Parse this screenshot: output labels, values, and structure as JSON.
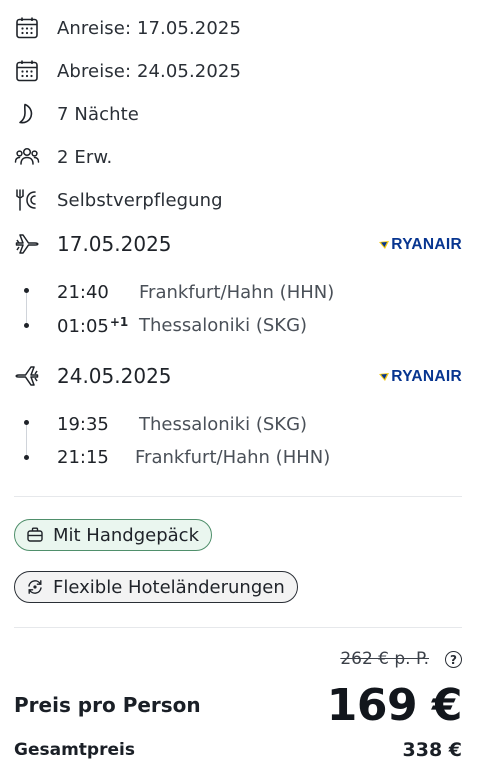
{
  "trip": {
    "arrival": "Anreise: 17.05.2025",
    "departure": "Abreise: 24.05.2025",
    "nights": "7 Nächte",
    "travellers": "2 Erw.",
    "board": "Selbstverpflegung"
  },
  "flights": [
    {
      "date": "17.05.2025",
      "airline": "RYANAIR",
      "icon": "plane-departure-icon",
      "segments": [
        {
          "time": "21:40",
          "day_offset": "",
          "place": "Frankfurt/Hahn (HHN)"
        },
        {
          "time": "01:05",
          "day_offset": "+1",
          "place": "Thessaloniki (SKG)"
        }
      ]
    },
    {
      "date": "24.05.2025",
      "airline": "RYANAIR",
      "icon": "plane-return-icon",
      "segments": [
        {
          "time": "19:35",
          "day_offset": "",
          "place": "Thessaloniki (SKG)"
        },
        {
          "time": "21:15",
          "day_offset": "",
          "place": "Frankfurt/Hahn (HHN)"
        }
      ]
    }
  ],
  "features": {
    "hand_luggage": "Mit Handgepäck",
    "flexible": "Flexible Hoteländerungen"
  },
  "pricing": {
    "old_price": "262 € p. P.",
    "help": "?",
    "per_person_label": "Preis pro Person",
    "per_person_value": "169 €",
    "total_label": "Gesamtpreis",
    "total_value": "338 €"
  },
  "colors": {
    "ryanair": "#073590",
    "ryanair_harp": "#F1C917",
    "chip_green_bg": "#eaf6ef",
    "chip_green_border": "#4f8f6b"
  }
}
